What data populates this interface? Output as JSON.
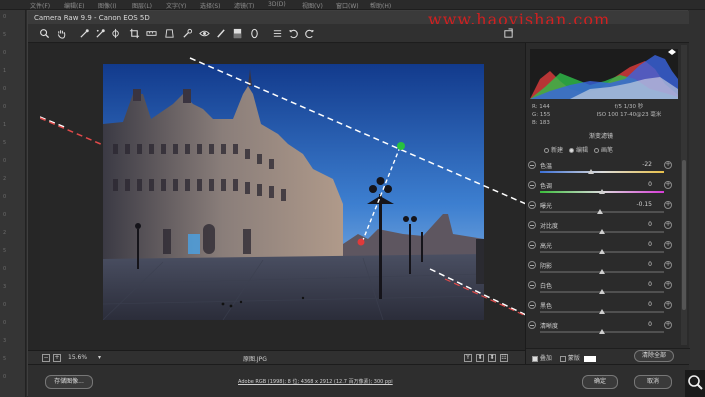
{
  "host": {
    "menu": [
      "文件(F)",
      "编辑(E)",
      "图像(I)",
      "图层(L)",
      "文字(Y)",
      "选择(S)",
      "滤镜(T)",
      "3D(D)",
      "视图(V)",
      "窗口(W)",
      "帮助(H)"
    ],
    "ruler": [
      "0",
      "5",
      "0",
      "1",
      "0",
      "0",
      "1",
      "5",
      "0",
      "2",
      "0",
      "0",
      "2",
      "5",
      "0",
      "3",
      "0",
      "0",
      "3",
      "5",
      "0"
    ]
  },
  "dialog": {
    "title": "Camera Raw 9.9  -  Canon EOS 5D",
    "watermark": "www.haoyishan.com"
  },
  "toolbar": {
    "tools": [
      "zoom-icon",
      "hand-icon",
      "white-balance-icon",
      "color-sampler-icon",
      "crop-icon",
      "straighten-icon",
      "transform-icon",
      "spot-removal-icon",
      "red-eye-icon",
      "adjustment-brush-icon",
      "graduated-filter-icon",
      "radial-filter-icon",
      "preferences-icon",
      "rotate-left-icon",
      "rotate-right-icon"
    ],
    "fullscreen_icon": "fullscreen-icon"
  },
  "status": {
    "minus": "−",
    "plus": "+",
    "zoom": "15.6%",
    "filename": "原图.JPG",
    "view_buttons": [
      "Y",
      "⬍",
      "⬍",
      "☷"
    ]
  },
  "footer": {
    "save_label": "存储图像...",
    "workflow": "Adobe RGB (1998); 8 位; 4368 x 2912 (12.7 百万像素); 300 ppi",
    "open_label": "确定",
    "cancel_label": "取消"
  },
  "panel": {
    "rgb": {
      "r": "R:  144",
      "g": "G:  155",
      "b": "B:  183"
    },
    "camera": {
      "line1": "f/5   1/30 秒",
      "line2": "ISO 100   17-40@23 毫米"
    },
    "title": "渐变滤镜",
    "modes": [
      {
        "label": "新建",
        "checked": false
      },
      {
        "label": "编辑",
        "checked": true
      },
      {
        "label": "画笔",
        "checked": false
      }
    ],
    "sliders": [
      {
        "label": "色温",
        "value": "-22",
        "pos": 0.41,
        "track": "linear-gradient(90deg,#3b6fd6,#ddd,#e7c04a)"
      },
      {
        "label": "色调",
        "value": "0",
        "pos": 0.5,
        "track": "linear-gradient(90deg,#3bbd3b,#ddd,#d63bd6)"
      },
      {
        "label": "曝光",
        "value": "-0.15",
        "pos": 0.48,
        "track": ""
      },
      {
        "label": "对比度",
        "value": "0",
        "pos": 0.5,
        "track": ""
      },
      {
        "label": "高光",
        "value": "0",
        "pos": 0.5,
        "track": ""
      },
      {
        "label": "阴影",
        "value": "0",
        "pos": 0.5,
        "track": ""
      },
      {
        "label": "白色",
        "value": "0",
        "pos": 0.5,
        "track": ""
      },
      {
        "label": "黑色",
        "value": "0",
        "pos": 0.5,
        "track": ""
      },
      {
        "label": "清晰度",
        "value": "0",
        "pos": 0.5,
        "track": ""
      }
    ],
    "overlay_label": "叠加",
    "overlay_checked": true,
    "mask_label": "蒙版",
    "mask_checked": false,
    "clear_label": "清除全部"
  },
  "colors": {
    "accent_green": "#27c23f",
    "accent_red": "#e03a3a",
    "dialog_bg": "#262626"
  }
}
